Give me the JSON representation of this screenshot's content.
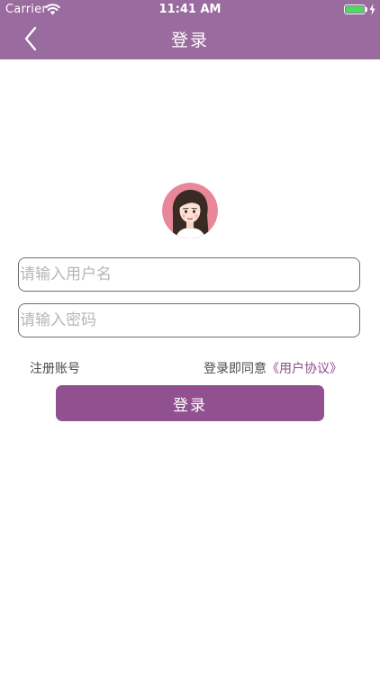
{
  "status_bar": {
    "carrier": "Carrier",
    "time": "11:41 AM",
    "battery_color": "#4cd964"
  },
  "nav": {
    "title": "登录",
    "back_icon": "chevron-left-icon",
    "background": "#9a6b9e"
  },
  "avatar": {
    "icon": "girl-avatar-icon"
  },
  "form": {
    "username_placeholder": "请输入用户名",
    "username_value": "",
    "password_placeholder": "请输入密码",
    "password_value": ""
  },
  "links": {
    "register": "注册账号",
    "agreement_prefix": "登录即同意",
    "agreement_link": "《用户协议》"
  },
  "login_button": {
    "label": "登录",
    "color": "#91508f"
  }
}
